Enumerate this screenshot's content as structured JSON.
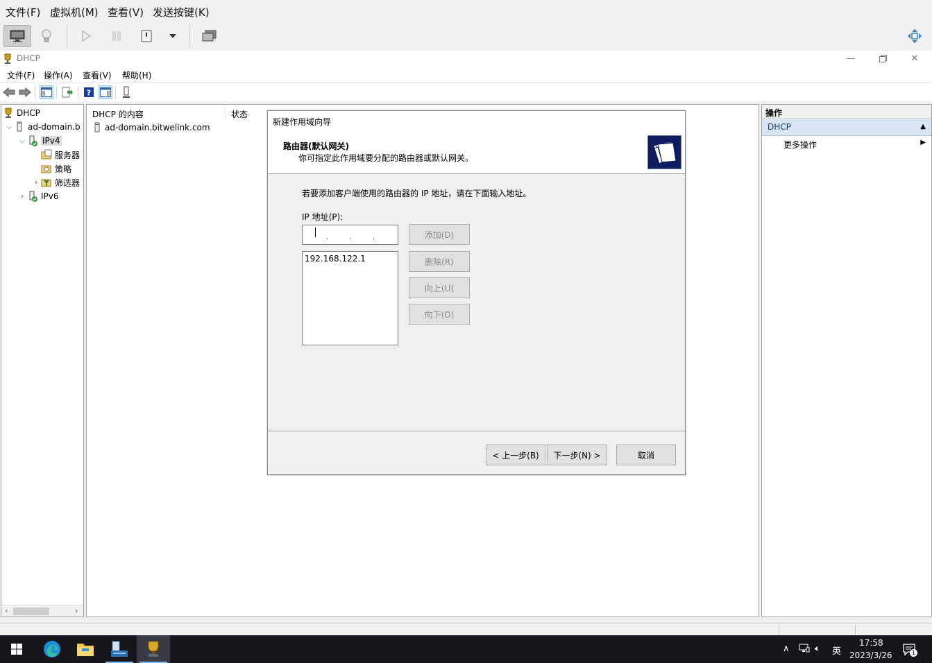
{
  "vm": {
    "menu": [
      "文件(F)",
      "虚拟机(M)",
      "查看(V)",
      "发送按键(K)"
    ]
  },
  "mmc": {
    "title": "DHCP",
    "menu": [
      "文件(F)",
      "操作(A)",
      "查看(V)",
      "帮助(H)"
    ],
    "tree": {
      "root": "DHCP",
      "server": "ad-domain.b",
      "ipv4": "IPv4",
      "server_options": "服务器",
      "policies": "策略",
      "filters": "筛选器",
      "ipv6": "IPv6"
    },
    "center": {
      "col_name": "DHCP 的内容",
      "col_status": "状态",
      "item": "ad-domain.bitwelink.com"
    },
    "actions": {
      "header": "操作",
      "group": "DHCP",
      "more": "更多操作"
    }
  },
  "wizard": {
    "title": "新建作用域向导",
    "heading": "路由器(默认网关)",
    "subheading": "你可指定此作用域要分配的路由器或默认网关。",
    "description": "若要添加客户端使用的路由器的 IP 地址，请在下面输入地址。",
    "ip_label": "IP 地址(P):",
    "ip_list": [
      "192.168.122.1"
    ],
    "buttons": {
      "add": "添加(D)",
      "remove": "删除(R)",
      "up": "向上(U)",
      "down": "向下(O)",
      "back": "< 上一步(B)",
      "next": "下一步(N) >",
      "cancel": "取消"
    }
  },
  "taskbar": {
    "time": "17:58",
    "date": "2023/3/26",
    "ime": "英",
    "notification_count": "1"
  },
  "colors": {
    "taskbar": "#16161c",
    "accent": "#76b9ed",
    "selection": "#d9e5f2"
  }
}
